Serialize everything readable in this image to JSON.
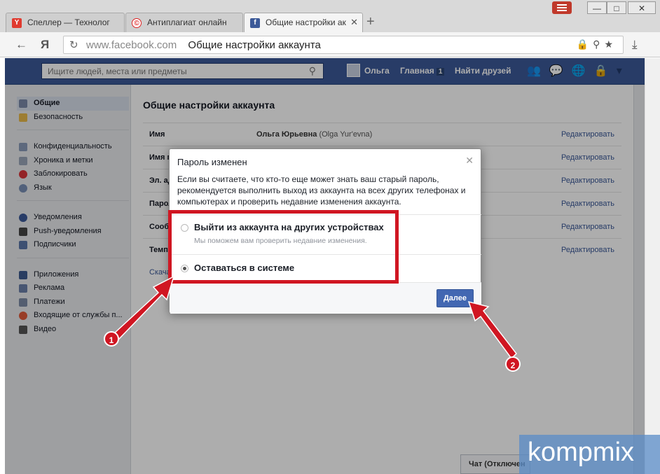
{
  "browser": {
    "tabs": [
      {
        "label": "Спеллер — Технолог",
        "favicon": "Y"
      },
      {
        "label": "Антиплагиат онлайн",
        "favicon": "©"
      },
      {
        "label": "Общие настройки ак",
        "favicon": "f"
      }
    ],
    "nav_yandex": "Я",
    "url_domain": "www.facebook.com",
    "url_title": "Общие настройки аккаунта"
  },
  "fb_header": {
    "search_placeholder": "Ищите людей, места или предметы",
    "user_name": "Ольга",
    "home_label": "Главная",
    "home_badge": "1",
    "find_friends_label": "Найти друзей"
  },
  "left_nav": {
    "group1": [
      "Общие",
      "Безопасность"
    ],
    "group2": [
      "Конфиденциальность",
      "Хроника и метки",
      "Заблокировать",
      "Язык"
    ],
    "group3": [
      "Уведомления",
      "Push-уведомления",
      "Подписчики"
    ],
    "group4": [
      "Приложения",
      "Реклама",
      "Платежи",
      "Входящие от службы п...",
      "Видео"
    ]
  },
  "settings": {
    "title": "Общие настройки аккаунта",
    "rows": [
      {
        "label": "Имя",
        "value_bold": "Ольга Юрьевна",
        "value_rest": " (Olga Yur'evna)",
        "edit": "Редактировать"
      },
      {
        "label": "Имя п",
        "value_bold": "",
        "value_rest": "",
        "edit": "Редактировать"
      },
      {
        "label": "Эл. ад",
        "value_bold": "",
        "value_rest": "",
        "edit": "Редактировать"
      },
      {
        "label": "Парол",
        "value_bold": "",
        "value_rest": "",
        "edit": "Редактировать"
      },
      {
        "label": "Сооб",
        "value_bold": "",
        "value_rest": "",
        "edit": "Редактировать"
      },
      {
        "label": "Темп",
        "value_bold": "",
        "value_rest": "",
        "edit": "Редактировать"
      }
    ],
    "download_link": "Скача"
  },
  "chat_label": "Чат (Отключен",
  "dialog": {
    "title": "Пароль изменен",
    "text": "Если вы считаете, что кто-то еще может знать ваш старый пароль, рекомендуется выполнить выход из аккаунта на всех других телефонах и компьютерах и проверить недавние изменения аккаунта.",
    "option1_label": "Выйти из аккаунта на других устройствах",
    "option1_sub": "Мы поможем вам проверить недавние изменения.",
    "option2_label": "Оставаться в системе",
    "selected_option": 2,
    "next_button": "Далее"
  },
  "annotations": {
    "badge1": "1",
    "badge2": "2",
    "color": "#d01622"
  },
  "watermark": "kompmix"
}
